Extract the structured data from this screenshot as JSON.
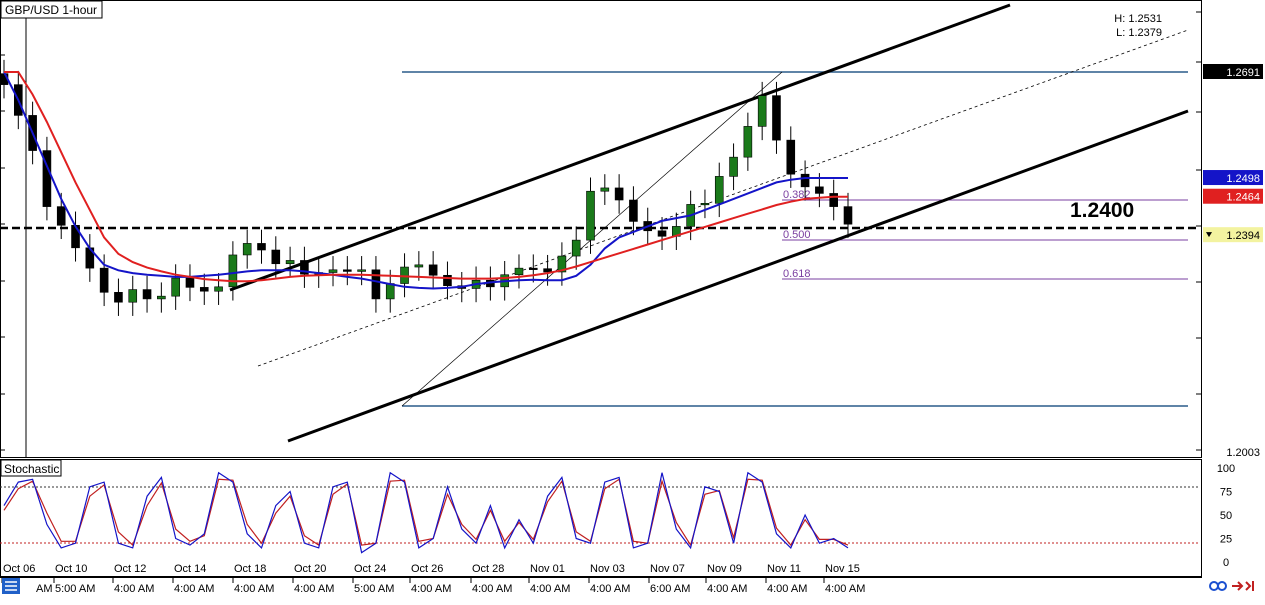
{
  "header": {
    "title": "GBP/USD 1-hour",
    "high_label": "H: 1.2531",
    "low_label": "L: 1.2379"
  },
  "colors": {
    "candle_up": "#1a7a1a",
    "candle_down": "#000000",
    "ma_fast": "#1414c8",
    "ma_slow": "#e02020",
    "channel": "#000000",
    "fib": "#7a3fa0",
    "range": "#2a5b8a",
    "stoch_k": "#1414c8",
    "stoch_d": "#c02020"
  },
  "chart_data": [
    {
      "type": "candlestick",
      "title": "GBP/USD 1-hour",
      "ylim": [
        1.2003,
        1.2691
      ],
      "price_labels": [
        {
          "value": "1.2691",
          "kind": "black"
        },
        {
          "value": "1.2498",
          "kind": "blue"
        },
        {
          "value": "1.2464",
          "kind": "red"
        },
        {
          "value": "1.2394",
          "kind": "yellow"
        },
        {
          "value": "1.2003",
          "kind": "plain"
        }
      ],
      "x_ticks": [
        "Oct 06",
        "Oct 10",
        "Oct 12",
        "Oct 14",
        "Oct 18",
        "Oct 20",
        "Oct 24",
        "Oct 26",
        "Oct 28",
        "Nov 01",
        "Nov 03",
        "Nov 07",
        "Nov 09",
        "Nov 11",
        "Nov 15"
      ],
      "x_tick_times": [
        "AM",
        "5:00 AM",
        "4:00 AM",
        "4:00 AM",
        "4:00 AM",
        "4:00 AM",
        "5:00 AM",
        "4:00 AM",
        "4:00 AM",
        "4:00 AM",
        "4:00 AM",
        "6:00 AM",
        "4:00 AM",
        "4:00 AM",
        "4:00 AM"
      ],
      "key_level": "1.2400",
      "fib_levels": [
        "0.382",
        "0.500",
        "0.618"
      ],
      "series": [
        {
          "name": "",
          "kind": "close",
          "values": [
            1.2668,
            1.2612,
            1.2548,
            1.2446,
            1.2412,
            1.2371,
            1.2334,
            1.229,
            1.2272,
            1.2295,
            1.2278,
            1.2283,
            1.2316,
            1.2299,
            1.2292,
            1.23,
            1.2358,
            1.2379,
            1.2367,
            1.2342,
            1.2348,
            1.2323,
            1.2326,
            1.2331,
            1.2328,
            1.2331,
            1.2278,
            1.2306,
            1.2336,
            1.234,
            1.2321,
            1.2302,
            1.2297,
            1.2312,
            1.23,
            1.2322,
            1.2334,
            1.2333,
            1.2327,
            1.2356,
            1.2385,
            1.2474,
            1.248,
            1.2458,
            1.2419,
            1.2402,
            1.2392,
            1.241,
            1.245,
            1.2452,
            1.2501,
            1.2536,
            1.2592,
            1.2648,
            1.2567,
            1.2505,
            1.2482,
            1.247,
            1.2446,
            1.2414
          ]
        },
        {
          "name": "",
          "kind": "ma_fast",
          "values": [
            1.2691,
            1.264,
            1.258,
            1.252,
            1.246,
            1.241,
            1.237,
            1.234,
            1.233,
            1.2325,
            1.2322,
            1.232,
            1.2318,
            1.2318,
            1.232,
            1.2322,
            1.2325,
            1.2328,
            1.233,
            1.233,
            1.233,
            1.2328,
            1.2325,
            1.2322,
            1.2318,
            1.2315,
            1.231,
            1.2305,
            1.23,
            1.2298,
            1.2297,
            1.2298,
            1.23,
            1.2305,
            1.2308,
            1.231,
            1.2312,
            1.2313,
            1.2312,
            1.2312,
            1.232,
            1.234,
            1.237,
            1.239,
            1.24,
            1.241,
            1.242,
            1.2425,
            1.243,
            1.244,
            1.245,
            1.246,
            1.247,
            1.248,
            1.249,
            1.2495,
            1.2498,
            1.2498,
            1.2498,
            1.2498
          ]
        },
        {
          "name": "",
          "kind": "ma_slow",
          "values": [
            1.2691,
            1.2691,
            1.265,
            1.26,
            1.2545,
            1.249,
            1.244,
            1.239,
            1.236,
            1.2345,
            1.2335,
            1.2328,
            1.2322,
            1.2318,
            1.2314,
            1.2312,
            1.231,
            1.231,
            1.2312,
            1.2315,
            1.2318,
            1.232,
            1.2321,
            1.2322,
            1.2322,
            1.2322,
            1.2321,
            1.232,
            1.2319,
            1.2318,
            1.2317,
            1.2316,
            1.2315,
            1.2315,
            1.2315,
            1.2316,
            1.2318,
            1.2321,
            1.2325,
            1.233,
            1.2337,
            1.2345,
            1.2353,
            1.2361,
            1.2369,
            1.2377,
            1.2385,
            1.2393,
            1.2401,
            1.2409,
            1.2417,
            1.2425,
            1.2433,
            1.2441,
            1.2449,
            1.2455,
            1.246,
            1.2462,
            1.2464,
            1.2464
          ]
        }
      ]
    },
    {
      "type": "line",
      "title": "Stochastic",
      "ylim": [
        0,
        100
      ],
      "y_ticks": [
        "100",
        "75",
        "50",
        "25",
        "0"
      ],
      "levels": [
        80,
        20
      ],
      "series": [
        {
          "name": "",
          "kind": "k",
          "values": [
            60,
            85,
            88,
            40,
            15,
            20,
            80,
            85,
            20,
            15,
            70,
            90,
            25,
            18,
            30,
            95,
            85,
            30,
            15,
            60,
            75,
            20,
            15,
            80,
            85,
            10,
            20,
            95,
            85,
            15,
            25,
            80,
            35,
            20,
            60,
            15,
            45,
            20,
            70,
            90,
            25,
            20,
            85,
            90,
            15,
            20,
            95,
            35,
            15,
            80,
            75,
            20,
            95,
            85,
            30,
            15,
            50,
            20,
            25,
            15
          ]
        },
        {
          "name": "",
          "kind": "d",
          "values": [
            55,
            78,
            86,
            52,
            22,
            22,
            70,
            82,
            32,
            18,
            60,
            84,
            35,
            22,
            28,
            88,
            87,
            40,
            20,
            52,
            70,
            28,
            18,
            72,
            83,
            18,
            20,
            86,
            87,
            22,
            25,
            72,
            40,
            24,
            55,
            22,
            42,
            24,
            64,
            86,
            32,
            22,
            78,
            88,
            22,
            20,
            86,
            42,
            18,
            72,
            76,
            26,
            88,
            87,
            36,
            18,
            45,
            24,
            24,
            18
          ]
        }
      ]
    }
  ]
}
